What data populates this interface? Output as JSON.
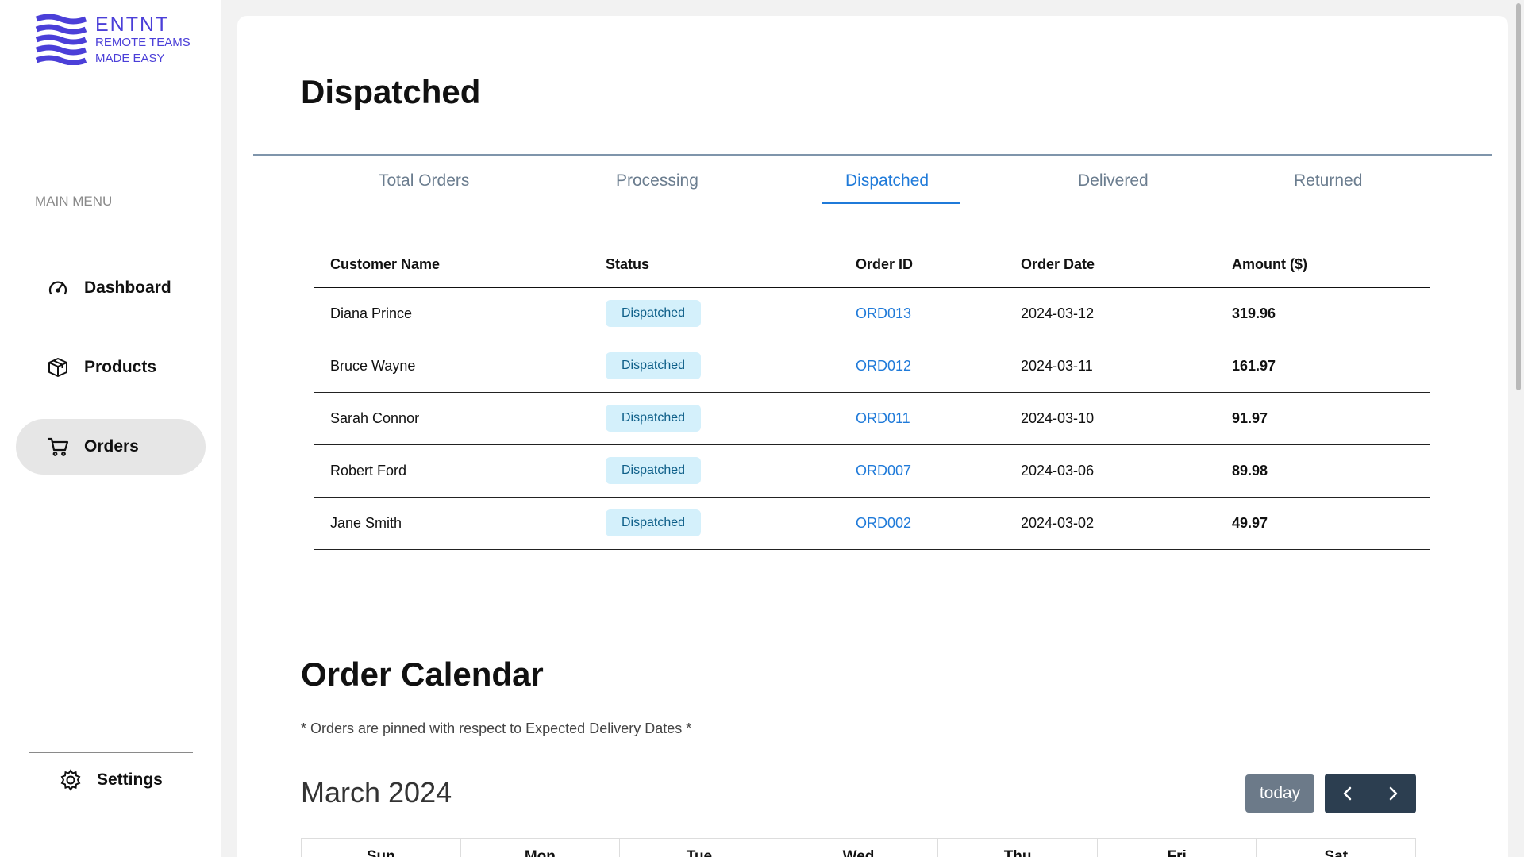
{
  "brand": {
    "title": "ENTNT",
    "line1": "REMOTE TEAMS",
    "line2": "MADE EASY",
    "color": "#4b3fd8"
  },
  "sidebar": {
    "menu_label": "MAIN MENU",
    "items": [
      {
        "label": "Dashboard",
        "icon": "speedometer-icon",
        "active": false
      },
      {
        "label": "Products",
        "icon": "box-icon",
        "active": false
      },
      {
        "label": "Orders",
        "icon": "cart-icon",
        "active": true
      }
    ],
    "settings_label": "Settings"
  },
  "main": {
    "title": "Dispatched",
    "tabs": [
      "Total Orders",
      "Processing",
      "Dispatched",
      "Delivered",
      "Returned"
    ],
    "active_tab": "Dispatched",
    "table": {
      "columns": [
        "Customer Name",
        "Status",
        "Order ID",
        "Order Date",
        "Amount ($)"
      ],
      "rows": [
        {
          "customer": "Diana Prince",
          "status": "Dispatched",
          "order_id": "ORD013",
          "date": "2024-03-12",
          "amount": "319.96"
        },
        {
          "customer": "Bruce Wayne",
          "status": "Dispatched",
          "order_id": "ORD012",
          "date": "2024-03-11",
          "amount": "161.97"
        },
        {
          "customer": "Sarah Connor",
          "status": "Dispatched",
          "order_id": "ORD011",
          "date": "2024-03-10",
          "amount": "91.97"
        },
        {
          "customer": "Robert Ford",
          "status": "Dispatched",
          "order_id": "ORD007",
          "date": "2024-03-06",
          "amount": "89.98"
        },
        {
          "customer": "Jane Smith",
          "status": "Dispatched",
          "order_id": "ORD002",
          "date": "2024-03-02",
          "amount": "49.97"
        }
      ]
    }
  },
  "calendar": {
    "title": "Order Calendar",
    "note": "* Orders are pinned with respect to Expected Delivery Dates *",
    "month": "March 2024",
    "today_label": "today",
    "days": [
      "Sun",
      "Mon",
      "Tue",
      "Wed",
      "Thu",
      "Fri",
      "Sat"
    ]
  },
  "colors": {
    "accent": "#1f7ad9",
    "badge_bg": "#d4f0fb",
    "nav_dark": "#2c3e50",
    "today_btn": "#6c7a89"
  }
}
